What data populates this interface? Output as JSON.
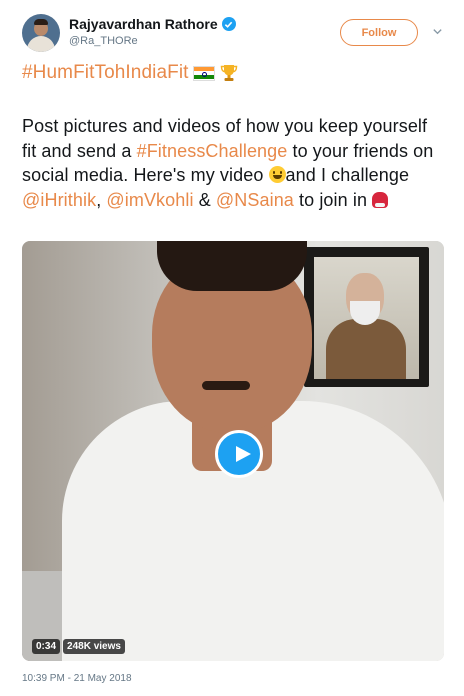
{
  "author": {
    "name": "Rajyavardhan Rathore",
    "handle": "@Ra_THORe"
  },
  "follow_label": "Follow",
  "hashtag_line": "#HumFitTohIndiaFit",
  "tweet": {
    "t1": "Post pictures and videos of how you keep yourself fit and send a ",
    "tag": "#FitnessChallenge",
    "t2": " to your friends on social media. Here's my video ",
    "t3": "and I challenge ",
    "m1": "@iHrithik",
    "t4": ", ",
    "m2": "@imVkohli",
    "t5": " & ",
    "m3": "@NSaina",
    "t6": " to join in "
  },
  "video": {
    "duration": "0:34",
    "views": "248K views"
  },
  "timestamp": "10:39 PM - 21 May 2018",
  "colors": {
    "accent": "#e8894a",
    "verified": "#1da1f2",
    "play": "#1da1f2"
  },
  "icons": [
    "verified-icon",
    "chevron-down-icon",
    "india-flag-icon",
    "trophy-icon",
    "grinning-face-icon",
    "boxing-glove-icon",
    "play-icon"
  ]
}
